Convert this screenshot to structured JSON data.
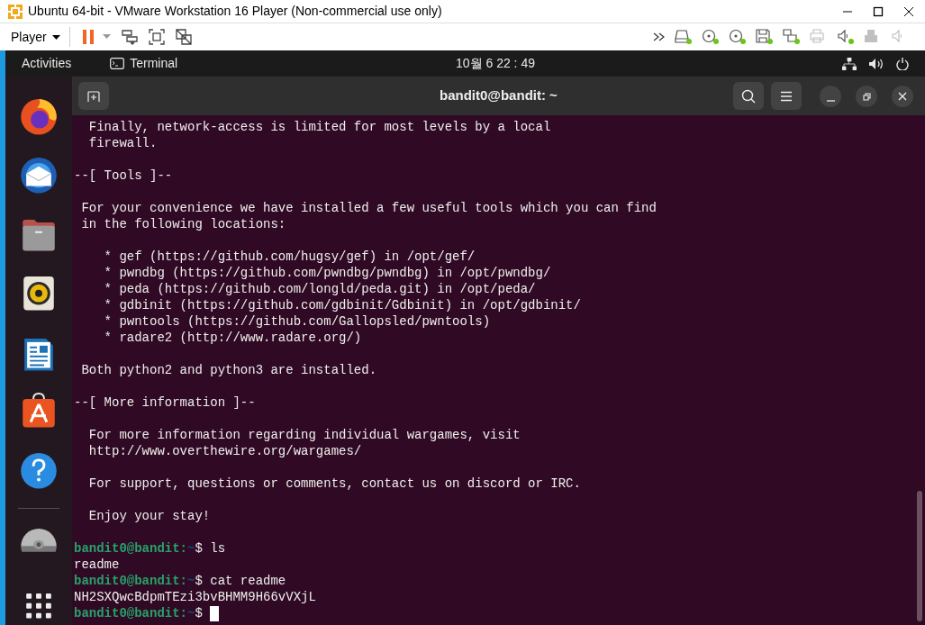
{
  "window": {
    "title": "Ubuntu 64-bit - VMware Workstation 16 Player (Non-commercial use only)"
  },
  "toolbar": {
    "menu": "Player",
    "devices": [
      {
        "kind": "disk",
        "active": true
      },
      {
        "kind": "cd",
        "active": true
      },
      {
        "kind": "cd",
        "active": true
      },
      {
        "kind": "floppy",
        "active": true
      },
      {
        "kind": "network",
        "active": true
      },
      {
        "kind": "printer",
        "active": false
      },
      {
        "kind": "sound",
        "active": true
      },
      {
        "kind": "usb",
        "active": false
      },
      {
        "kind": "sound",
        "active": false
      }
    ]
  },
  "top_bar": {
    "activities": "Activities",
    "app": "Terminal",
    "clock": "10월 6  22 : 49"
  },
  "dock": [
    {
      "kind": "firefox"
    },
    {
      "kind": "mail"
    },
    {
      "kind": "files"
    },
    {
      "kind": "speaker"
    },
    {
      "kind": "writer"
    },
    {
      "kind": "store"
    },
    {
      "kind": "help"
    },
    {
      "kind": "separator"
    },
    {
      "kind": "disc"
    },
    {
      "kind": "grid"
    }
  ],
  "terminal": {
    "title": "bandit0@bandit: ~",
    "blocks": [
      [
        "  Finally, network-access is limited for most levels by a local",
        "  firewall."
      ],
      [
        "--[ Tools ]--"
      ],
      [
        " For your convenience we have installed a few useful tools which you can find",
        " in the following locations:"
      ],
      [
        "    * gef (https://github.com/hugsy/gef) in /opt/gef/",
        "    * pwndbg (https://github.com/pwndbg/pwndbg) in /opt/pwndbg/",
        "    * peda (https://github.com/longld/peda.git) in /opt/peda/",
        "    * gdbinit (https://github.com/gdbinit/Gdbinit) in /opt/gdbinit/",
        "    * pwntools (https://github.com/Gallopsled/pwntools)",
        "    * radare2 (http://www.radare.org/)"
      ],
      [
        " Both python2 and python3 are installed."
      ],
      [
        "--[ More information ]--"
      ],
      [
        "  For more information regarding individual wargames, visit",
        "  http://www.overthewire.org/wargames/"
      ],
      [
        "  For support, questions or comments, contact us on discord or IRC."
      ],
      [
        "  Enjoy your stay!"
      ]
    ],
    "session": [
      {
        "kind": "prompt",
        "user": "bandit0@bandit:",
        "path": "~",
        "symbol": "$",
        "command": " ls",
        "cursor": false
      },
      {
        "kind": "output",
        "text": "readme"
      },
      {
        "kind": "prompt",
        "user": "bandit0@bandit:",
        "path": "~",
        "symbol": "$",
        "command": " cat readme",
        "cursor": false
      },
      {
        "kind": "output",
        "text": "NH2SXQwcBdpmTEzi3bvBHMM9H66vVXjL"
      },
      {
        "kind": "prompt",
        "user": "bandit0@bandit:",
        "path": "~",
        "symbol": "$",
        "cursor": true
      }
    ]
  }
}
